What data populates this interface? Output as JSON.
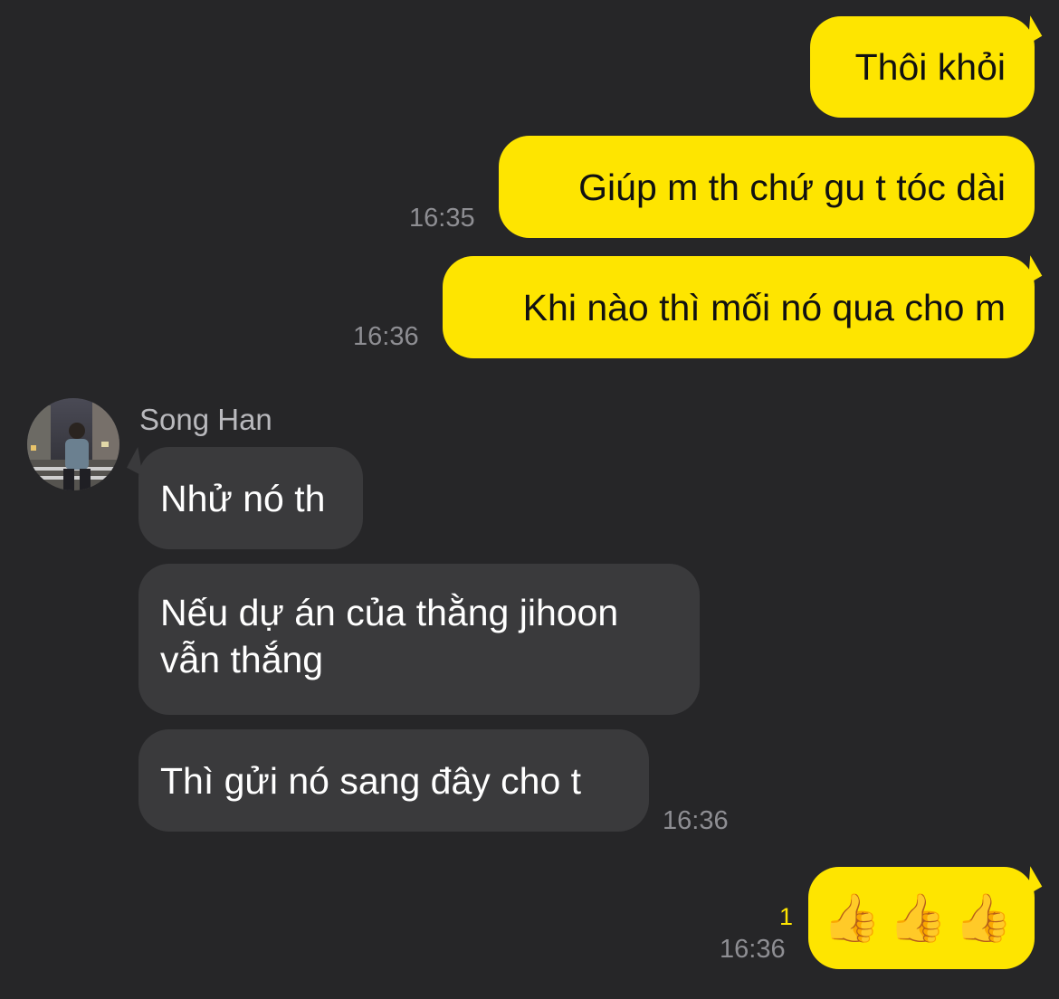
{
  "conversation": {
    "messages": [
      {
        "direction": "outgoing",
        "text": "Thôi khỏi",
        "time": ""
      },
      {
        "direction": "outgoing",
        "text": "Giúp m th chứ gu t tóc dài",
        "time": "16:35"
      },
      {
        "direction": "outgoing",
        "text": "Khi nào thì mối nó qua cho m",
        "time": "16:36"
      },
      {
        "direction": "incoming",
        "sender": "Song Han",
        "text": "Nhử nó th",
        "time": ""
      },
      {
        "direction": "incoming",
        "text": "Nếu dự án của thằng jihoon vẫn thắng",
        "time": ""
      },
      {
        "direction": "incoming",
        "text": "Thì gửi nó sang đây cho t",
        "time": "16:36"
      },
      {
        "direction": "outgoing",
        "text": "👍👍👍",
        "time": "16:36",
        "unread_count": "1"
      }
    ]
  },
  "colors": {
    "background": "#262628",
    "outgoing_bubble": "#FEE500",
    "incoming_bubble": "#3a3a3c",
    "timestamp": "#8e8e93",
    "unread_count": "#FEE500"
  },
  "icons": {
    "avatar": "profile-photo-avatar"
  }
}
